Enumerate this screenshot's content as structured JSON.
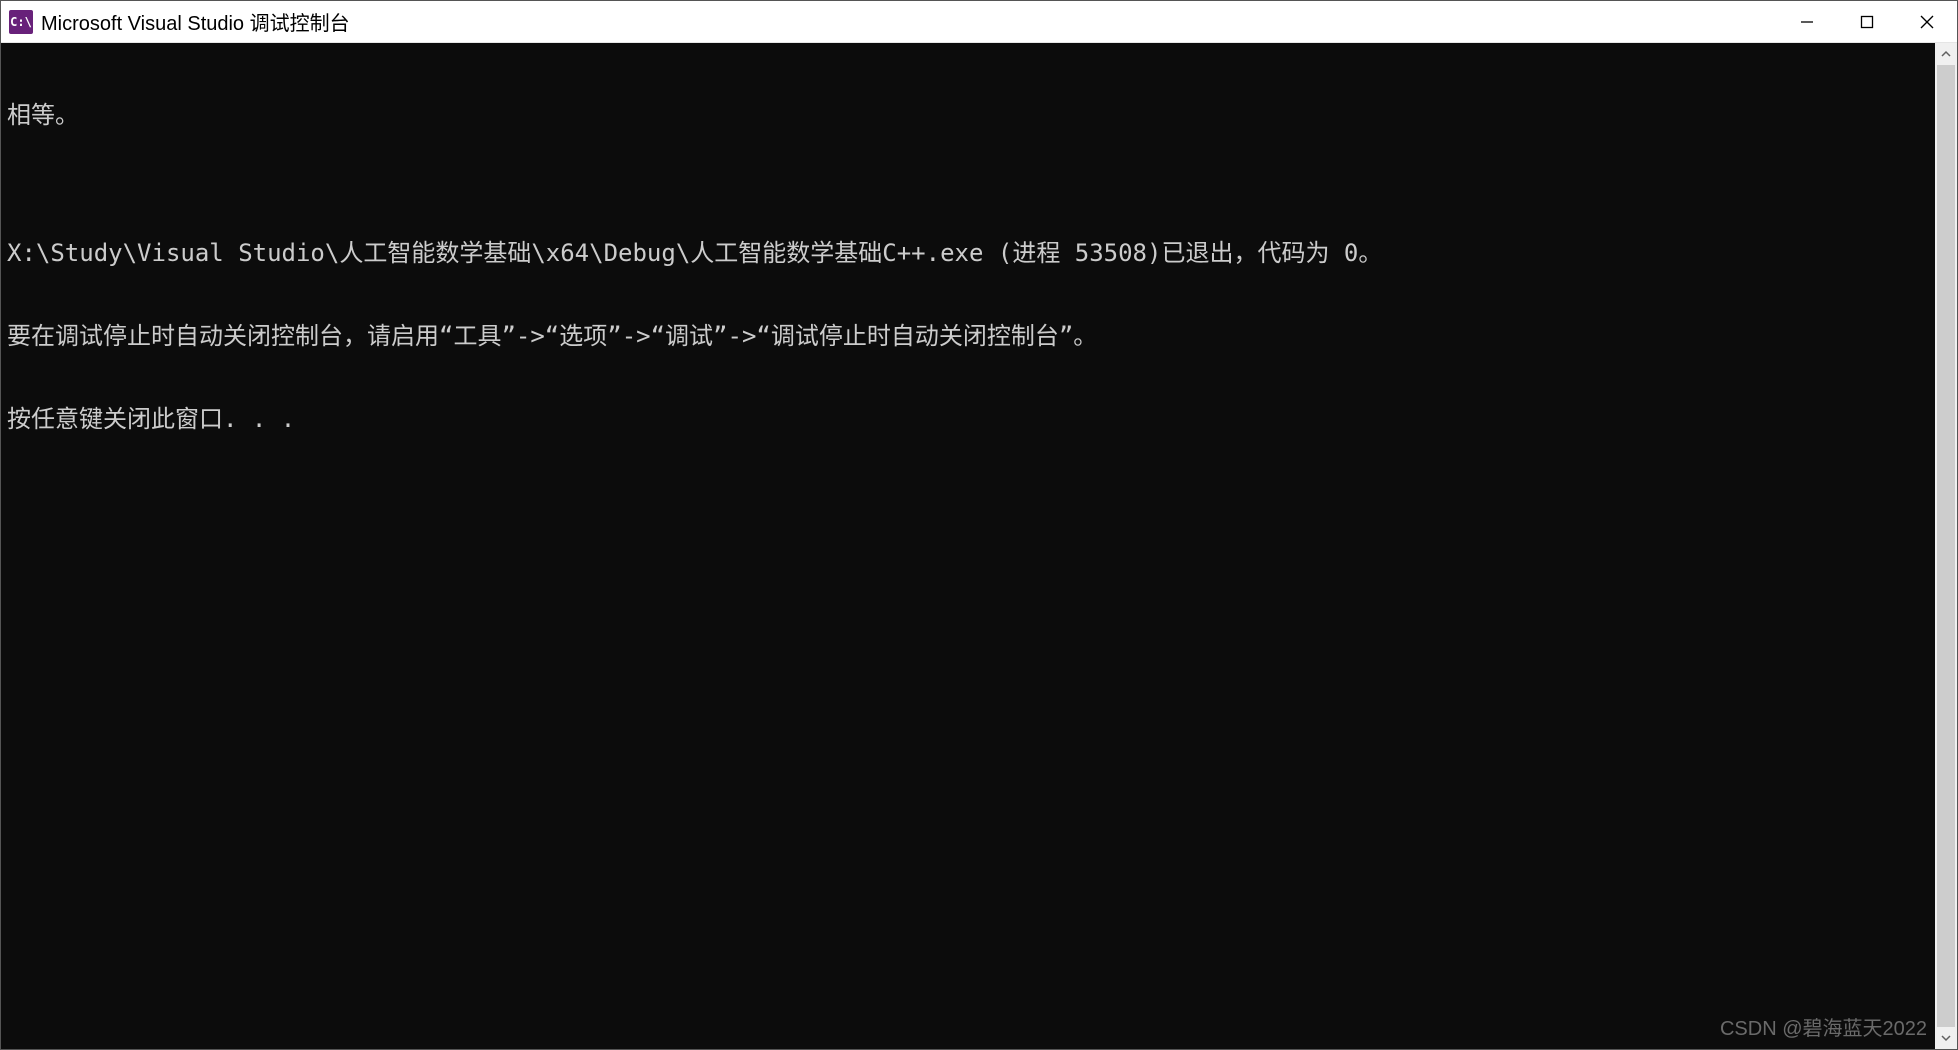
{
  "window": {
    "title": "Microsoft Visual Studio 调试控制台",
    "icon_text": "C:\\"
  },
  "console": {
    "lines": [
      "相等。",
      "",
      "X:\\Study\\Visual Studio\\人工智能数学基础\\x64\\Debug\\人工智能数学基础C++.exe (进程 53508)已退出，代码为 0。",
      "要在调试停止时自动关闭控制台，请启用“工具”->“选项”->“调试”->“调试停止时自动关闭控制台”。",
      "按任意键关闭此窗口. . ."
    ]
  },
  "watermark": "CSDN @碧海蓝天2022"
}
